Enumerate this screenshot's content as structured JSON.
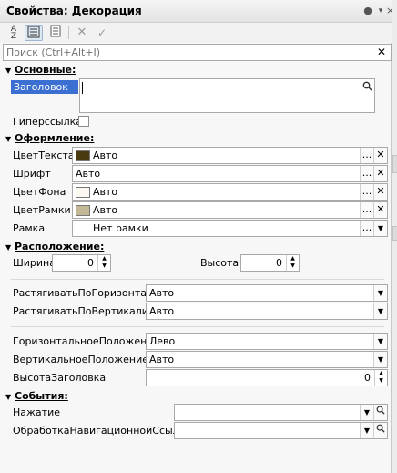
{
  "window": {
    "title": "Свойства: Декорация"
  },
  "title_icons": [
    "pin-icon",
    "settings-icon",
    "close-icon"
  ],
  "search": {
    "placeholder": "Поиск (Ctrl+Alt+I)"
  },
  "groups": {
    "main": "Основные:",
    "design": "Оформление:",
    "location": "Расположение:",
    "events": "События:"
  },
  "main": {
    "title_label": "Заголовок",
    "hyperlink_label": "Гиперссылка",
    "hyperlink_checked": false
  },
  "design": {
    "text_color": {
      "label": "ЦветТекста",
      "value": "Авто",
      "swatch": "#4a3a10"
    },
    "font": {
      "label": "Шрифт",
      "value": "Авто"
    },
    "bg_color": {
      "label": "ЦветФона",
      "value": "Авто",
      "swatch": "#faf8f0"
    },
    "border_color": {
      "label": "ЦветРамки",
      "value": "Авто",
      "swatch": "#c3b796"
    },
    "border": {
      "label": "Рамка",
      "value": "Нет рамки"
    }
  },
  "location": {
    "width_label": "Ширина",
    "width_value": "0",
    "height_label": "Высота",
    "height_value": "0",
    "stretch_h_label": "РастягиватьПоГоризонтали",
    "stretch_h_value": "Авто",
    "stretch_v_label": "РастягиватьПоВертикали",
    "stretch_v_value": "Авто",
    "h_pos_label": "ГоризонтальноеПоложение",
    "h_pos_value": "Лево",
    "v_pos_label": "ВертикальноеПоложение",
    "v_pos_value": "Авто",
    "title_height_label": "ВысотаЗаголовка",
    "title_height_value": "0"
  },
  "events": {
    "click_label": "Нажатие",
    "nav_label": "ОбработкаНавигационнойСсылки"
  },
  "colors": {
    "selection": "#3b6fd1",
    "border": "#a9a9a9"
  }
}
